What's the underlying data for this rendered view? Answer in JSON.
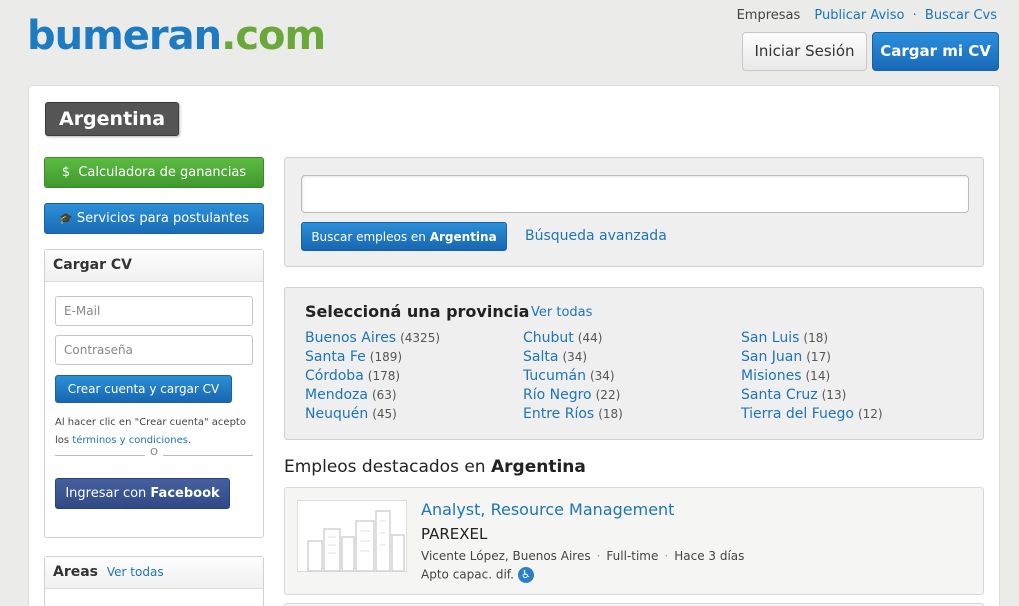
{
  "header": {
    "logo_main": "bumeran",
    "logo_dot": ".",
    "logo_tld": "com",
    "links": [
      "Empresas",
      "Publicar Aviso",
      "Buscar Cvs"
    ],
    "login_label": "Iniciar Sesión",
    "upload_cv_label": "Cargar mi CV"
  },
  "country": "Argentina",
  "sidebar": {
    "calculator_label": "Calculadora de ganancias",
    "calculator_icon": "$",
    "services_label": "Servicios para postulantes",
    "services_icon": "🎓",
    "cv_panel": {
      "title": "Cargar CV",
      "email_placeholder": "E-Mail",
      "password_placeholder": "Contraseña",
      "create_button": "Crear cuenta y cargar CV",
      "note_prefix": "Al hacer clic en \"Crear cuenta\" acepto los ",
      "terms_link": "términos y condiciones",
      "note_suffix": ".",
      "or_text": "O",
      "facebook_prefix": "Ingresar con ",
      "facebook_brand": "Facebook"
    },
    "areas_panel": {
      "title": "Areas",
      "see_all": "Ver todas"
    }
  },
  "search": {
    "input_value": "",
    "button_prefix": "Buscar empleos en ",
    "button_country": "Argentina",
    "advanced_link": "Búsqueda avanzada"
  },
  "provinces": {
    "title": "Seleccioná una provincia",
    "see_all": "Ver todas",
    "columns": [
      [
        {
          "name": "Buenos Aires",
          "count": "(4325)"
        },
        {
          "name": "Santa Fe",
          "count": "(189)"
        },
        {
          "name": "Córdoba",
          "count": "(178)"
        },
        {
          "name": "Mendoza",
          "count": "(63)"
        },
        {
          "name": "Neuquén",
          "count": "(45)"
        }
      ],
      [
        {
          "name": "Chubut",
          "count": "(44)"
        },
        {
          "name": "Salta",
          "count": "(34)"
        },
        {
          "name": "Tucumán",
          "count": "(34)"
        },
        {
          "name": "Río Negro",
          "count": "(22)"
        },
        {
          "name": "Entre Ríos",
          "count": "(18)"
        }
      ],
      [
        {
          "name": "San Luis",
          "count": "(18)"
        },
        {
          "name": "San Juan",
          "count": "(17)"
        },
        {
          "name": "Misiones",
          "count": "(14)"
        },
        {
          "name": "Santa Cruz",
          "count": "(13)"
        },
        {
          "name": "Tierra del Fuego",
          "count": "(12)"
        }
      ]
    ]
  },
  "featured": {
    "title_prefix": "Empleos destacados en ",
    "title_country": "Argentina",
    "jobs": [
      {
        "title": "Analyst, Resource Management",
        "company": "PAREXEL",
        "location": "Vicente López, Buenos Aires",
        "type": "Full-time",
        "posted": "Hace 3 días",
        "apto": "Apto capac. dif."
      }
    ]
  },
  "colors": {
    "brand_blue": "#1e7bc2",
    "brand_green": "#6aa83a",
    "facebook": "#3b5998"
  }
}
